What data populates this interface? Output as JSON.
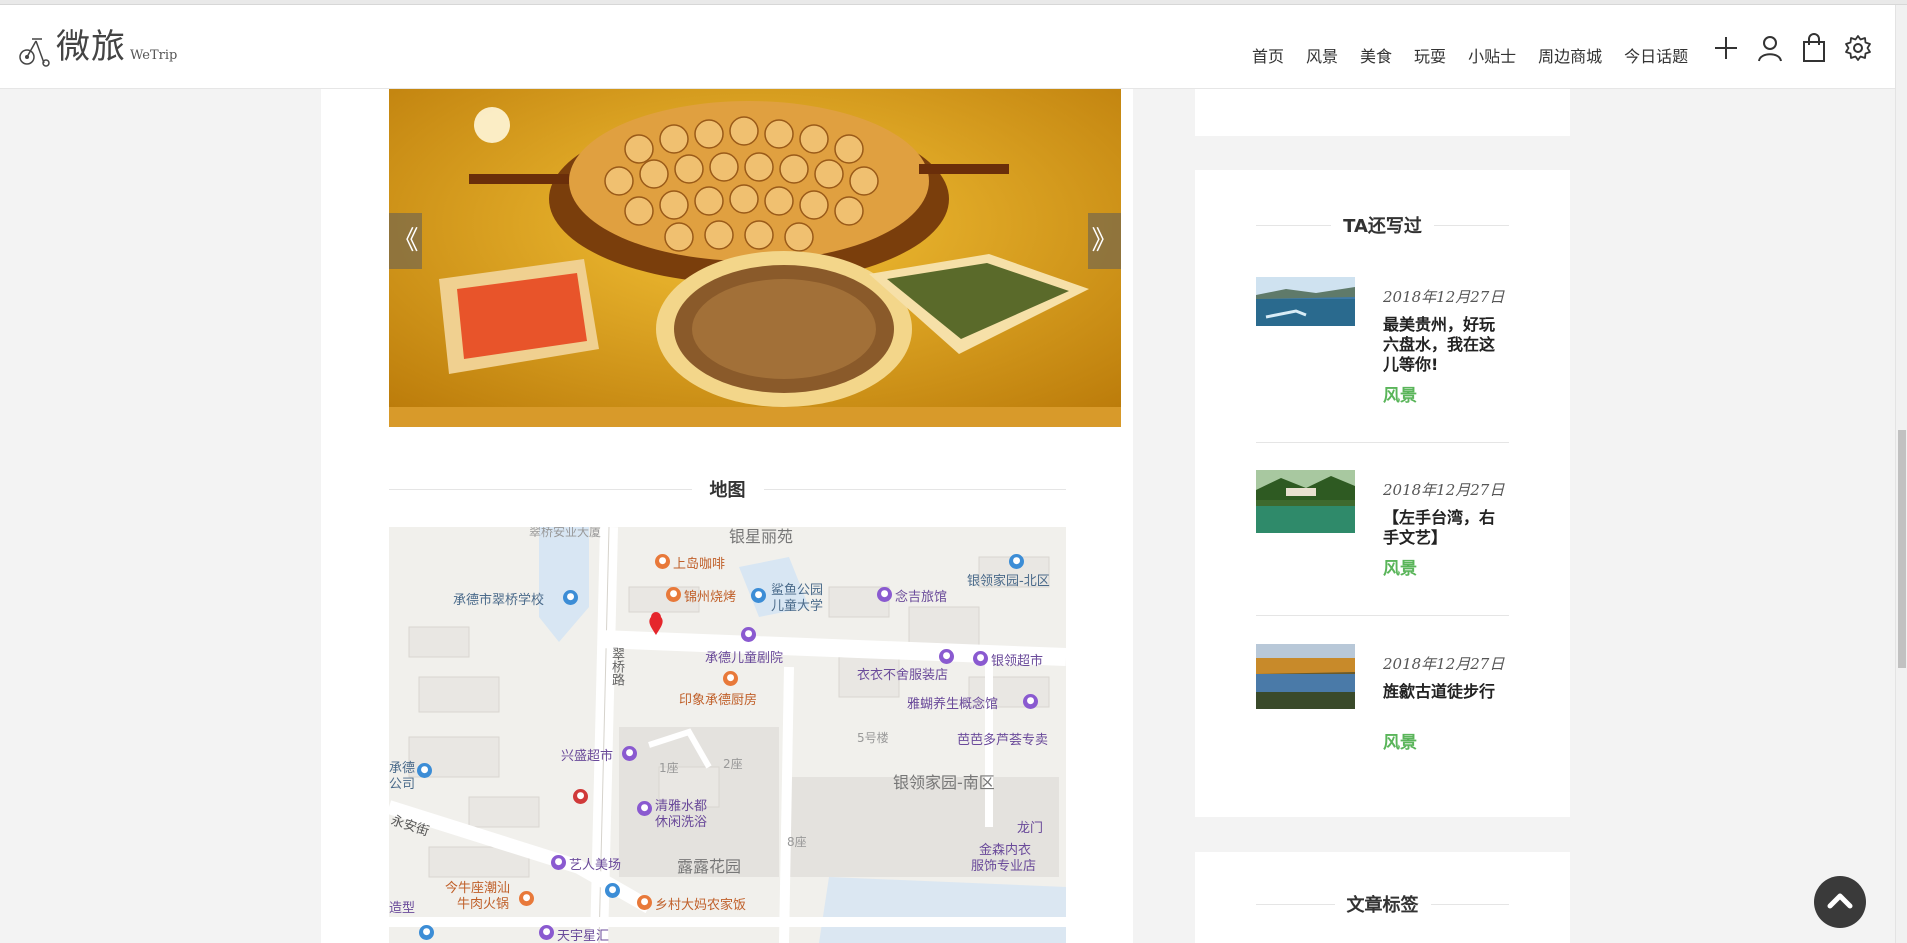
{
  "header": {
    "logo_cn": "微旅",
    "logo_en": "WeTrip",
    "nav": [
      "首页",
      "风景",
      "美食",
      "玩耍",
      "小贴士",
      "周边商城",
      "今日话题"
    ]
  },
  "icons": {
    "nav_icons": [
      "plus-icon",
      "user-icon",
      "bag-icon",
      "settings-gear-icon"
    ]
  },
  "gallery": {
    "prev": "《",
    "next": "》"
  },
  "map_section": {
    "title": "地图",
    "labels": {
      "school": "承德市翠桥学校",
      "cafe": "上岛咖啡",
      "jinzhou": "锦州烧烤",
      "park": "鲨鱼公园",
      "park2": "儿童大学",
      "inn": "念吉旅馆",
      "yinling_north": "银领家园-北区",
      "theater": "承德儿童剧院",
      "supermarket": "银领超市",
      "clothing": "衣衣不舍服装店",
      "kitchen": "印象承德厨房",
      "yahu": "雅蝴养生概念馆",
      "road": "翠桥路",
      "bldg5": "5号楼",
      "babaduo": "芭芭多芦荟专卖",
      "xingsheng": "兴盛超市",
      "bldg1": "1座",
      "bldg2": "2座",
      "yinling_south": "银领家园-南区",
      "qingya": "清雅水都",
      "qingya2": "休闲洗浴",
      "yongan": "永安街",
      "lulu": "露露花园",
      "bldg8": "8座",
      "jinsen": "金森内衣",
      "jinsen2": "服饰专业店",
      "yiren": "艺人美场",
      "niurou": "今牛座潮汕",
      "niurou2": "牛肉火锅",
      "xiangcun": "乡村大妈农家饭",
      "tianyu": "天宇星汇",
      "yinxing": "银星丽苑",
      "cuiqiao_top": "翠桥安业大厦",
      "chengde_gongsi": "承德",
      "gongsi": "公司",
      "long": "龙门",
      "zaoxing": "造型"
    }
  },
  "sidebar": {
    "related_title": "TA还写过",
    "posts": [
      {
        "date": "2018年12月27日",
        "title": "最美贵州，好玩六盘水，我在这儿等你!",
        "category": "风景"
      },
      {
        "date": "2018年12月27日",
        "title": "【左手台湾，右手文艺】",
        "category": "风景"
      },
      {
        "date": "2018年12月27日",
        "title": "旌歙古道徒步行",
        "category": "风景"
      }
    ],
    "tags_title": "文章标签"
  }
}
